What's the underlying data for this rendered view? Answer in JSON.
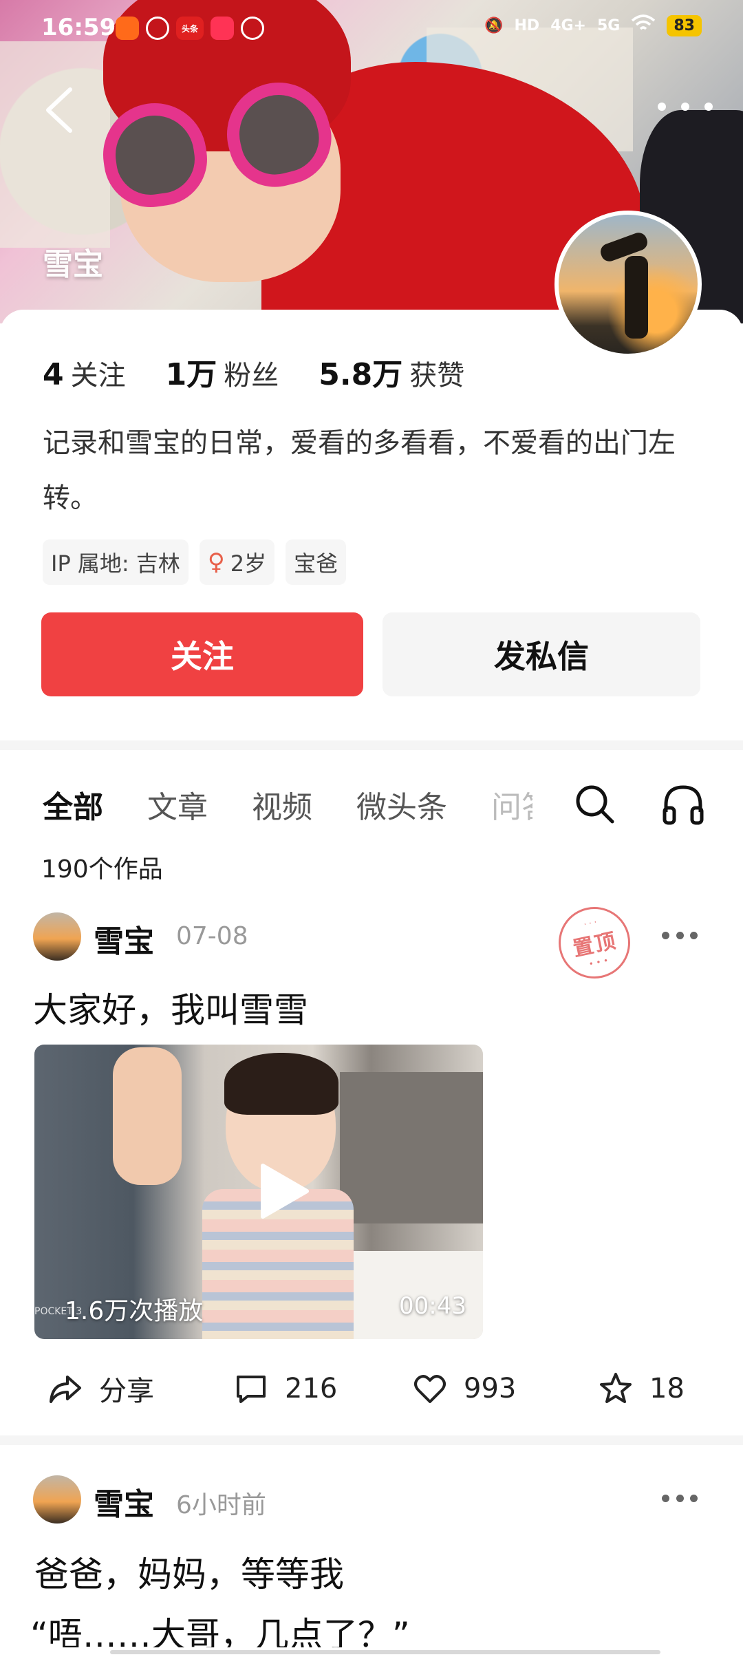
{
  "status_bar": {
    "time": "16:59",
    "signal_labels": [
      "HD",
      "4G+",
      "5G"
    ],
    "battery": "83",
    "app_badge": "头条"
  },
  "banner": {
    "display_name": "雪宝"
  },
  "profile": {
    "stats": [
      {
        "num": "4",
        "label": "关注"
      },
      {
        "num": "1万",
        "label": "粉丝"
      },
      {
        "num": "5.8万",
        "label": "获赞"
      }
    ],
    "bio": "记录和雪宝的日常，爱看的多看看，不爱看的出门左转。",
    "tags": {
      "ip": "IP 属地: 吉林",
      "age": "2岁",
      "role": "宝爸"
    },
    "follow_label": "关注",
    "message_label": "发私信"
  },
  "tabs": {
    "items": [
      "全部",
      "文章",
      "视频",
      "微头条",
      "问答"
    ],
    "active_index": 0,
    "works_count": "190个作品"
  },
  "posts": [
    {
      "author": "雪宝",
      "time": "07-08",
      "pinned_label": "置顶",
      "title": "大家好，我叫雪雪",
      "video": {
        "plays": "1.6万次播放",
        "duration": "00:43",
        "watermark": "POCKET 3"
      },
      "actions": {
        "share": "分享",
        "comments": "216",
        "likes": "993",
        "favorites": "18"
      }
    },
    {
      "author": "雪宝",
      "time": "6小时前",
      "title_line1": "爸爸，妈妈，等等我",
      "title_line2": "“唔……大哥，几点了？”"
    }
  ]
}
